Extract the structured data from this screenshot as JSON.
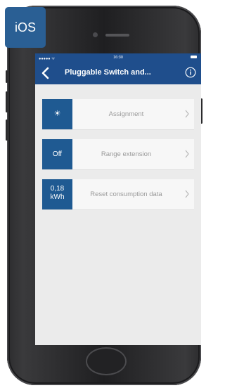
{
  "badge": {
    "label": "iOS"
  },
  "status_bar": {
    "time": "16:30",
    "signal": "●●●●● ᯤ"
  },
  "nav": {
    "title": "Pluggable Switch and..."
  },
  "rows": [
    {
      "tile_text": "☀",
      "label": "Assignment",
      "tile_icon": "sun-icon"
    },
    {
      "tile_text": "Off",
      "label": "Range extension"
    },
    {
      "tile_text_line1": "0,18",
      "tile_text_line2": "kWh",
      "label": "Reset consumption data"
    }
  ],
  "colors": {
    "nav_blue": "#1f4e8c",
    "tile_blue": "#1f5a92",
    "badge_blue": "#2a5f94",
    "screen_bg": "#ebebeb"
  }
}
